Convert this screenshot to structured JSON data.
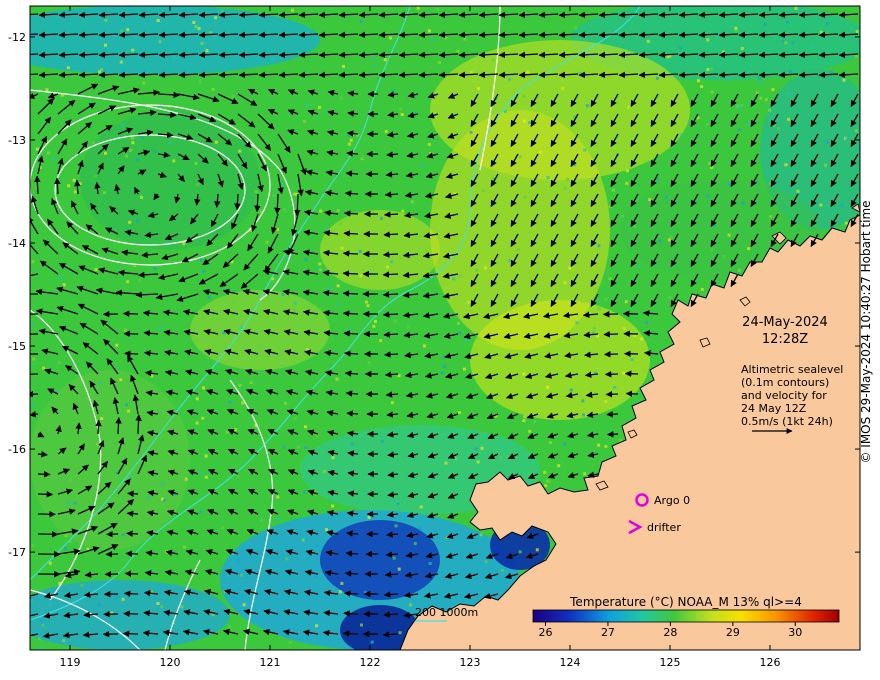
{
  "map": {
    "lon_ticks": [
      "119",
      "120",
      "121",
      "122",
      "123",
      "124",
      "125",
      "126"
    ],
    "lat_ticks": [
      "-12",
      "-13",
      "-14",
      "-15",
      "-16",
      "-17"
    ],
    "lon_range": [
      118.6,
      126.9
    ],
    "lat_range": [
      -17.95,
      -11.7
    ]
  },
  "annotations": {
    "date": "24-May-2024",
    "time": "12:28Z",
    "desc_lines": [
      "Altimetric sealevel",
      "(0.1m contours)",
      "and velocity for",
      "24 May 12Z",
      "0.5m/s (1kt 24h)"
    ]
  },
  "legend": {
    "argo_label": "Argo 0",
    "drifter_label": "drifter",
    "bathy_label": "200  1000m",
    "colorbar_title": "Temperature (°C) NOAA_M 13% ql>=4",
    "colorbar_ticks": [
      "26",
      "27",
      "28",
      "29",
      "30"
    ],
    "colorbar_range": [
      25.8,
      30.7
    ]
  },
  "credit": "© IMOS 29-May-2024 10:40:27 Hobart time",
  "colors": {
    "land": "#f9c89c",
    "ocean_base": "#3cc83c",
    "contour": "#ffffff",
    "bathy": "#40e0e8",
    "argo": "#e000e0",
    "drifter": "#e000e0"
  }
}
